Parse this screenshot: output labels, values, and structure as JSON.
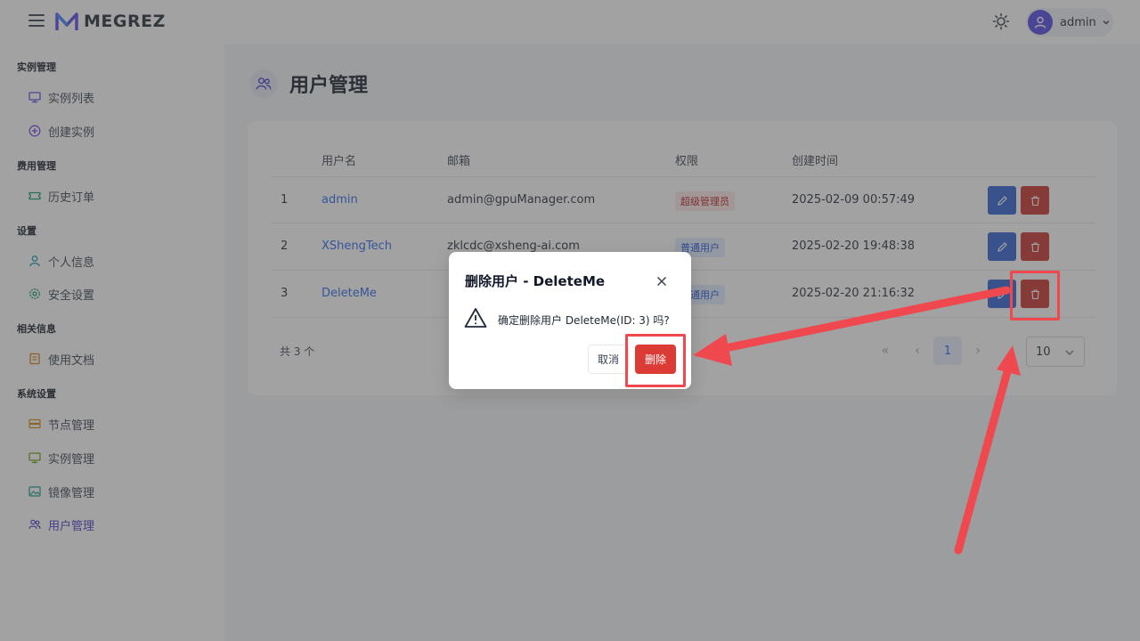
{
  "app": {
    "logo_text": "MEGREZ",
    "user": "admin"
  },
  "sidebar": {
    "groups": [
      {
        "title": "实例管理",
        "items": [
          {
            "label": "实例列表",
            "icon": "monitor-icon"
          },
          {
            "label": "创建实例",
            "icon": "plus-circle-icon"
          }
        ]
      },
      {
        "title": "费用管理",
        "items": [
          {
            "label": "历史订单",
            "icon": "ticket-icon"
          }
        ]
      },
      {
        "title": "设置",
        "items": [
          {
            "label": "个人信息",
            "icon": "user-icon"
          },
          {
            "label": "安全设置",
            "icon": "gear-icon"
          }
        ]
      },
      {
        "title": "相关信息",
        "items": [
          {
            "label": "使用文档",
            "icon": "book-icon"
          }
        ]
      },
      {
        "title": "系统设置",
        "items": [
          {
            "label": "节点管理",
            "icon": "server-icon"
          },
          {
            "label": "实例管理",
            "icon": "monitor-icon"
          },
          {
            "label": "镜像管理",
            "icon": "image-icon"
          },
          {
            "label": "用户管理",
            "icon": "users-icon",
            "active": true
          }
        ]
      }
    ]
  },
  "page": {
    "title": "用户管理"
  },
  "table": {
    "headers": [
      "用户名",
      "邮箱",
      "权限",
      "创建时间"
    ],
    "rows": [
      {
        "id": "1",
        "username": "admin",
        "email": "admin@gpuManager.com",
        "role": "超级管理员",
        "created": "2025-02-09 00:57:49"
      },
      {
        "id": "2",
        "username": "XShengTech",
        "email": "zklcdc@xsheng-ai.com",
        "role": "普通用户",
        "created": "2025-02-20 19:48:38"
      },
      {
        "id": "3",
        "username": "DeleteMe",
        "email": "",
        "role": "通用户",
        "created": "2025-02-20 21:16:32"
      }
    ]
  },
  "pagination": {
    "total": "共 3 个",
    "first": "«",
    "prev": "‹",
    "current": "1",
    "next": "›",
    "page_size": "10"
  },
  "dialog": {
    "title": "删除用户 - DeleteMe",
    "message": "确定删除用户 DeleteMe(ID: 3) 吗?",
    "cancel": "取消",
    "confirm": "删除"
  },
  "colors": {
    "accent": "#4f46e5",
    "danger": "#dc3a35",
    "annotation": "#f0484f"
  }
}
